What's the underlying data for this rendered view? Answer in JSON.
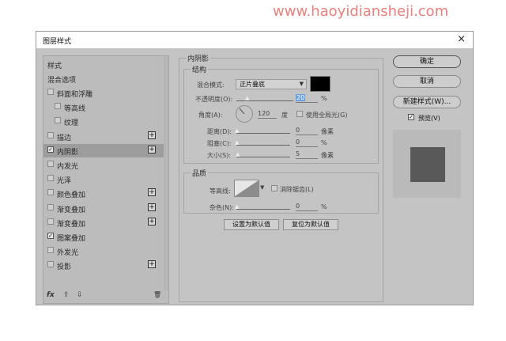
{
  "watermark": "www.haoyidiansheji.com",
  "dialog": {
    "title": "图层样式",
    "close_glyph": "×"
  },
  "left_panel": {
    "header": "样式",
    "blend_options": "混合选项",
    "items": [
      {
        "label": "斜面和浮雕",
        "checked": false,
        "plus": false,
        "indent": 0
      },
      {
        "label": "等高线",
        "checked": false,
        "plus": false,
        "indent": 1
      },
      {
        "label": "纹理",
        "checked": false,
        "plus": false,
        "indent": 1
      },
      {
        "label": "描边",
        "checked": false,
        "plus": true,
        "indent": 0
      },
      {
        "label": "内阴影",
        "checked": true,
        "plus": true,
        "indent": 0,
        "selected": true
      },
      {
        "label": "内发光",
        "checked": false,
        "plus": false,
        "indent": 0
      },
      {
        "label": "光泽",
        "checked": false,
        "plus": false,
        "indent": 0
      },
      {
        "label": "颜色叠加",
        "checked": false,
        "plus": true,
        "indent": 0
      },
      {
        "label": "渐变叠加",
        "checked": false,
        "plus": true,
        "indent": 0
      },
      {
        "label": "渐变叠加",
        "checked": false,
        "plus": true,
        "indent": 0
      },
      {
        "label": "图案叠加",
        "checked": true,
        "plus": false,
        "indent": 0
      },
      {
        "label": "外发光",
        "checked": false,
        "plus": false,
        "indent": 0
      },
      {
        "label": "投影",
        "checked": false,
        "plus": true,
        "indent": 0
      }
    ],
    "footer": {
      "fx": "fx",
      "up": "⇧",
      "down": "⇩",
      "trash": "🗑"
    }
  },
  "inner_shadow": {
    "title": "内阴影",
    "structure": {
      "title": "结构",
      "blend_mode_label": "混合模式:",
      "blend_mode_value": "正片叠底",
      "shadow_color": "#000000",
      "opacity_label": "不透明度(O):",
      "opacity_value": "20",
      "percent": "%",
      "angle_label": "角度(A):",
      "angle_value": "120",
      "degree_unit": "度",
      "global_light_label": "使用全局光(G)",
      "distance_label": "距离(D):",
      "distance_value": "0",
      "px_unit": "像素",
      "choke_label": "阻塞(C):",
      "choke_value": "0",
      "size_label": "大小(S):",
      "size_value": "5"
    },
    "quality": {
      "title": "品质",
      "contour_label": "等高线:",
      "antialias_label": "消除锯齿(L)",
      "noise_label": "杂色(N):",
      "noise_value": "0"
    },
    "set_default_button": "设置为默认值",
    "reset_default_button": "复位为默认值"
  },
  "actions": {
    "ok": "确定",
    "cancel": "取消",
    "new_style": "新建样式(W)...",
    "preview_label": "预览(V)",
    "preview_checked": true,
    "preview_fill": "#595959"
  }
}
